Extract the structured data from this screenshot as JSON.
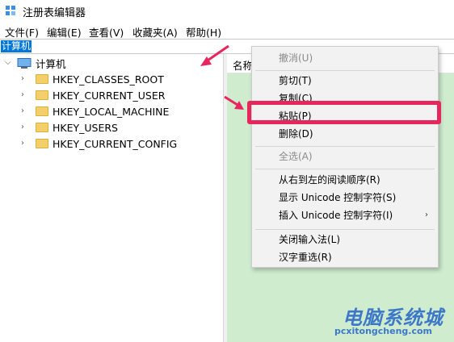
{
  "window": {
    "title": "注册表编辑器"
  },
  "menu": [
    {
      "label": "文件(F)"
    },
    {
      "label": "编辑(E)"
    },
    {
      "label": "查看(V)"
    },
    {
      "label": "收藏夹(A)"
    },
    {
      "label": "帮助(H)"
    }
  ],
  "address": {
    "value": "计算机"
  },
  "tree": {
    "root": "计算机",
    "keys": [
      "HKEY_CLASSES_ROOT",
      "HKEY_CURRENT_USER",
      "HKEY_LOCAL_MACHINE",
      "HKEY_USERS",
      "HKEY_CURRENT_CONFIG"
    ]
  },
  "list": {
    "column_name": "名称"
  },
  "context_menu": {
    "undo": "撤消(U)",
    "cut": "剪切(T)",
    "copy": "复制(C)",
    "paste": "粘贴(P)",
    "delete": "删除(D)",
    "select_all": "全选(A)",
    "rtl": "从右到左的阅读顺序(R)",
    "show_unicode": "显示 Unicode 控制字符(S)",
    "insert_unicode": "插入 Unicode 控制字符(I)",
    "close_ime": "关闭输入法(L)",
    "reconvert": "汉字重选(R)"
  },
  "watermark": {
    "main": "电脑系统城",
    "sub": "pcxitongcheng.com"
  },
  "colors": {
    "selection": "#0078d7",
    "list_background": "#cfeccf",
    "annotation": "#e8265e",
    "watermark": "#3d78c8"
  }
}
